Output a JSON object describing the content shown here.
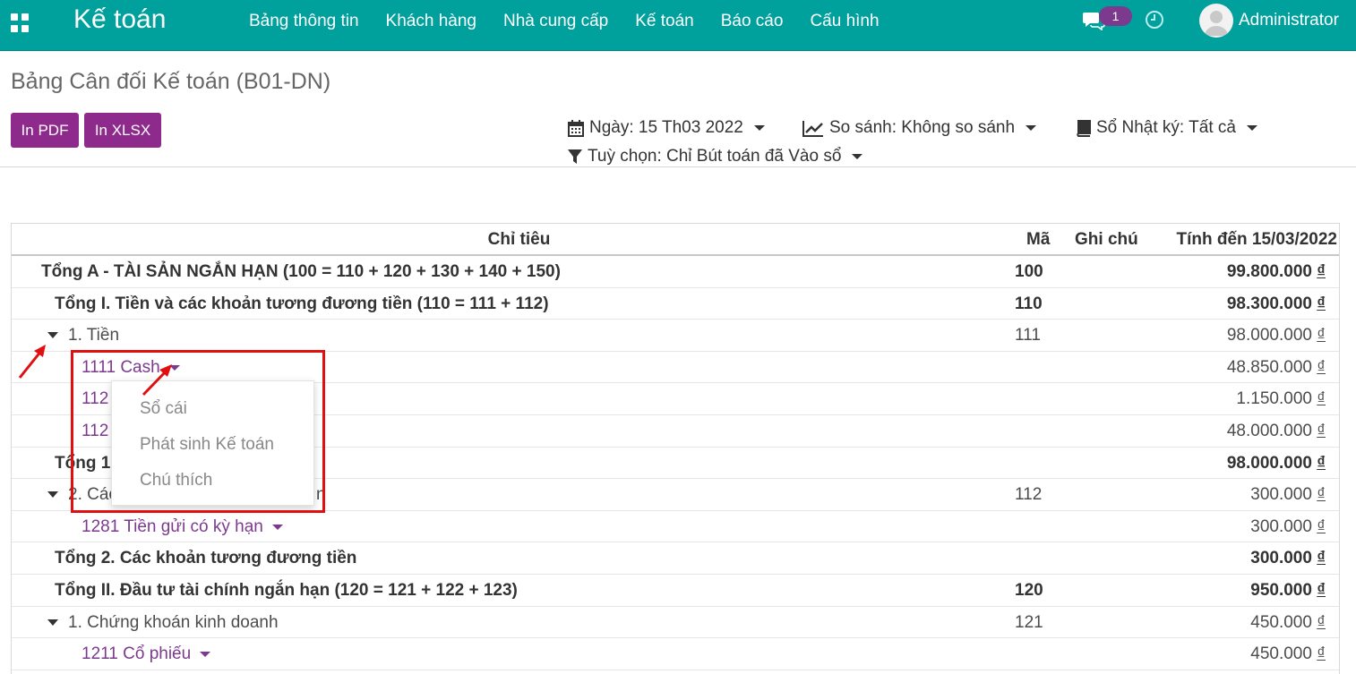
{
  "navbar": {
    "app_title": "Kế toán",
    "menu": [
      "Bảng thông tin",
      "Khách hàng",
      "Nhà cung cấp",
      "Kế toán",
      "Báo cáo",
      "Cấu hình"
    ],
    "chat_badge": "1",
    "user_name": "Administrator",
    "accent_color": "#00a09d"
  },
  "control_panel": {
    "title": "Bảng Cân đối Kế toán (B01-DN)",
    "print_pdf_label": "In PDF",
    "print_xlsx_label": "In XLSX",
    "date_filter": "Ngày: 15 Th03 2022",
    "compare_filter": "So sánh: Không so sánh",
    "journal_filter": "Sổ Nhật ký: Tất cả",
    "options_filter": "Tuỳ chọn: Chỉ Bút toán đã Vào sổ"
  },
  "table": {
    "headers": {
      "name": "Chỉ tiêu",
      "code": "Mã",
      "note": "Ghi chú",
      "amount": "Tính đến 15/03/2022"
    },
    "rows": [
      {
        "name": "Tổng A - TÀI SẢN NGẮN HẠN (100 = 110 + 120 + 130 + 140 + 150)",
        "code": "100",
        "amount": "99.800.000",
        "currency": "₫"
      },
      {
        "name": "Tổng I. Tiền và các khoản tương đương tiền (110 = 111 + 112)",
        "code": "110",
        "amount": "98.300.000",
        "currency": "₫"
      },
      {
        "name": "1. Tiền",
        "code": "111",
        "amount": "98.000.000",
        "currency": "₫"
      },
      {
        "name": "1111 Cash",
        "code": "",
        "amount": "48.850.000",
        "currency": "₫"
      },
      {
        "name": "112",
        "code": "",
        "amount": "1.150.000",
        "currency": "₫"
      },
      {
        "name": "112",
        "code": "",
        "amount": "48.000.000",
        "currency": "₫"
      },
      {
        "name": "Tổng 1.",
        "code": "",
        "amount": "98.000.000",
        "currency": "₫"
      },
      {
        "name": "2. Các",
        "suffix": "n",
        "code": "112",
        "amount": "300.000",
        "currency": "₫"
      },
      {
        "name": "1281 Tiền gửi có kỳ hạn",
        "code": "",
        "amount": "300.000",
        "currency": "₫"
      },
      {
        "name": "Tổng 2. Các khoản tương đương tiền",
        "code": "",
        "amount": "300.000",
        "currency": "₫"
      },
      {
        "name": "Tổng II. Đầu tư tài chính ngắn hạn (120 = 121 + 122 + 123)",
        "code": "120",
        "amount": "950.000",
        "currency": "₫"
      },
      {
        "name": "1. Chứng khoán kinh doanh",
        "code": "121",
        "amount": "450.000",
        "currency": "₫"
      },
      {
        "name": "1211 Cổ phiếu",
        "code": "",
        "amount": "450.000",
        "currency": "₫"
      }
    ]
  },
  "dropdown": {
    "items": [
      "Sổ cái",
      "Phát sinh Kế toán",
      "Chú thích"
    ]
  }
}
